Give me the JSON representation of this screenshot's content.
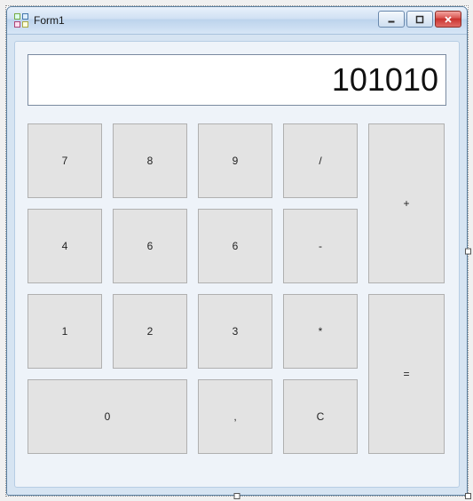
{
  "window": {
    "title": "Form1"
  },
  "display": {
    "value": "101010"
  },
  "buttons": {
    "k7": "7",
    "k8": "8",
    "k9": "9",
    "div": "/",
    "k4": "4",
    "k6": "6",
    "k6b": "6",
    "sub": "-",
    "k1": "1",
    "k2": "2",
    "k3": "3",
    "mul": "*",
    "k0": "0",
    "comma": ",",
    "clear": "C",
    "add": "+",
    "eq": "="
  }
}
